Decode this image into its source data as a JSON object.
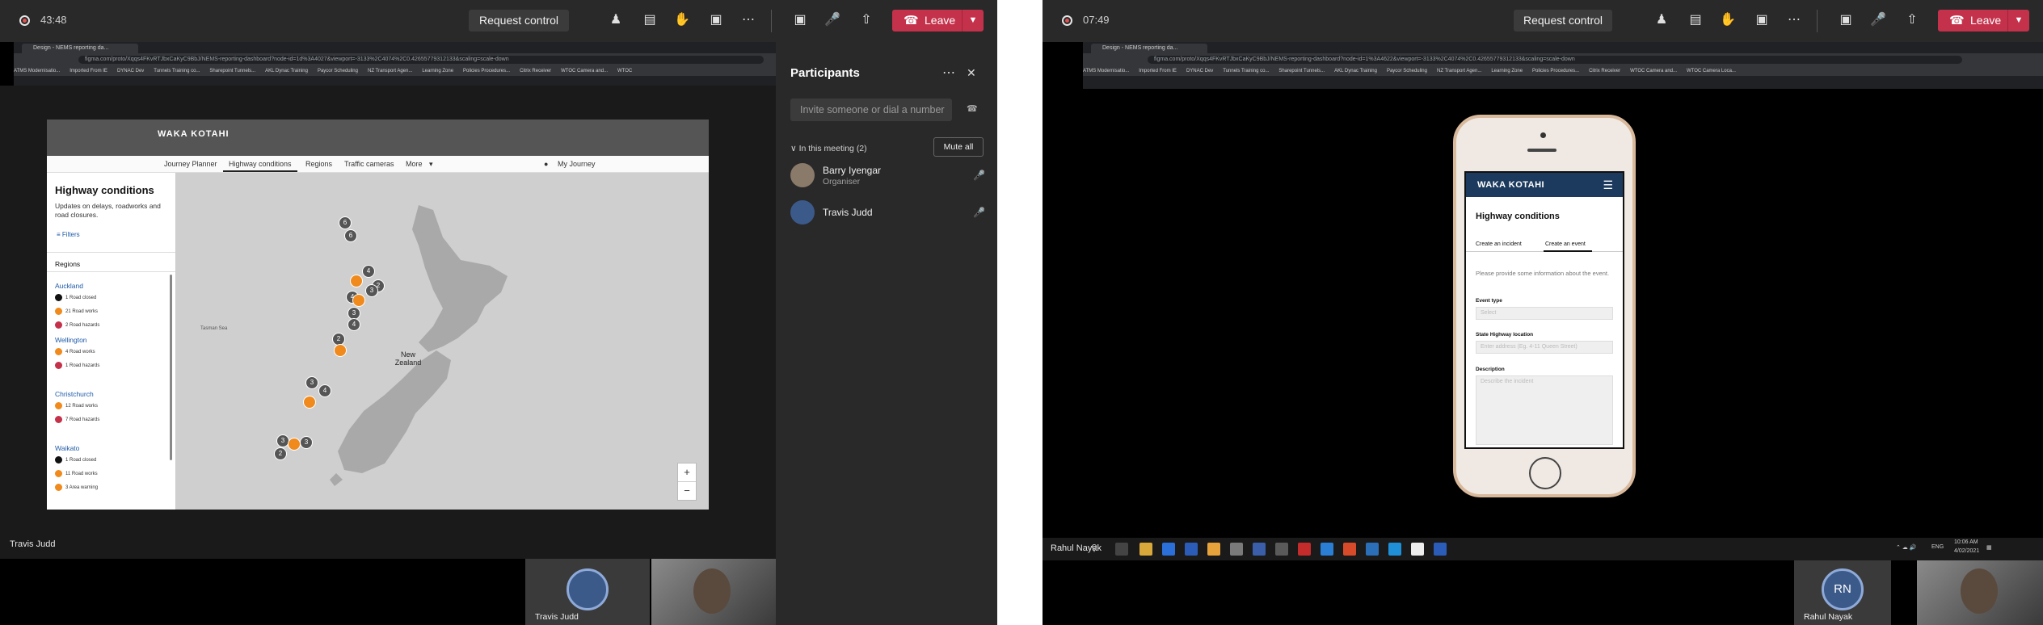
{
  "left": {
    "timer": "43:48",
    "request_control": "Request control",
    "leave": "Leave",
    "toolbar_icons": [
      "people-icon",
      "chat-icon",
      "raise-hand-icon",
      "rooms-icon",
      "more-icon",
      "camera-icon",
      "mic-icon",
      "share-icon"
    ],
    "browser": {
      "tab": "Design - NEMS reporting da...",
      "url": "figma.com/proto/Xqqs4FKvRTJbxCaKyC9BbJ/NEMS-reporting-dashboard?node-id=1d%3A4027&viewport=-3133%2C4074%2C0.42655779312133&scaling=scale-down",
      "bookmarks": [
        "ATMS Modernisatio...",
        "Imported From IE",
        "DYNAC Dev",
        "Tunnels Training co...",
        "Sharepoint Tunnels...",
        "AKL Dynac Training",
        "Paycor Scheduling",
        "NZ Transport Agen...",
        "Learning Zone",
        "Policies Procedures...",
        "Citrix Receiver",
        "WTOC Camera and...",
        "WTOC"
      ]
    },
    "figma": {
      "logo": "WAKA KOTAHI",
      "nav": [
        "Journey Planner",
        "Highway conditions",
        "Regions",
        "Traffic cameras",
        "More"
      ],
      "account": "My Journey",
      "title": "Highway conditions",
      "subtitle": "Updates on delays, roadworks and road closures.",
      "filters": "Filters",
      "regions_label": "Regions",
      "regions": [
        {
          "name": "Auckland",
          "items": [
            "1 Road closed",
            "21 Road works",
            "2 Road hazards"
          ]
        },
        {
          "name": "Wellington",
          "items": [
            "4 Road works",
            "1 Road hazards"
          ]
        },
        {
          "name": "Christchurch",
          "items": [
            "12 Road works",
            "7 Road hazards"
          ]
        },
        {
          "name": "Waikato",
          "items": [
            "1 Road closed",
            "11 Road works",
            "3 Area warning"
          ]
        }
      ],
      "map_labels": {
        "sea": "Tasman Sea",
        "country": "New Zealand"
      },
      "markers": [
        "6",
        "6",
        "4",
        "2",
        "3",
        "4",
        "3",
        "2",
        "4",
        "3",
        "4",
        "3",
        "2"
      ],
      "zoom_in": "+",
      "zoom_out": "−"
    },
    "presenter_name": "Travis Judd",
    "participants": {
      "title": "Participants",
      "invite_placeholder": "Invite someone or dial a number",
      "in_meeting": "In this meeting (2)",
      "mute_all": "Mute all",
      "people": [
        {
          "name": "Barry Iyengar",
          "role": "Organiser"
        },
        {
          "name": "Travis Judd",
          "role": ""
        }
      ]
    },
    "tiles": [
      {
        "name": "Travis Judd"
      },
      {
        "name": ""
      }
    ]
  },
  "right": {
    "timer": "07:49",
    "request_control": "Request control",
    "leave": "Leave",
    "browser": {
      "tab": "Design - NEMS reporting da...",
      "url": "figma.com/proto/Xqqs4FKvRTJbxCaKyC9BbJ/NEMS-reporting-dashboard?node-id=1%3A4622&viewport=-3133%2C4074%2C0.42655779312133&scaling=scale-down",
      "bookmarks": [
        "ATMS Modernisatio...",
        "Imported From IE",
        "DYNAC Dev",
        "Tunnels Training co...",
        "Sharepoint Tunnels...",
        "AKL Dynac Training",
        "Paycor Scheduling",
        "NZ Transport Agen...",
        "Learning Zone",
        "Policies Procedures...",
        "Citrix Receiver",
        "WTOC Camera and...",
        "WTOC Camera Loca..."
      ]
    },
    "phone": {
      "logo": "WAKA KOTAHI",
      "title": "Highway conditions",
      "tabs": [
        "Create an incident",
        "Create an event"
      ],
      "info": "Please provide some information about the event.",
      "event_type_label": "Event type",
      "event_type_placeholder": "Select",
      "location_label": "State Highway location",
      "location_placeholder": "Enter address (Eg. 4-11 Queen Street)",
      "description_label": "Description",
      "description_placeholder": "Describe the incident"
    },
    "presenter_name": "Rahul Nayak",
    "taskbar": {
      "lang": "ENG",
      "time": "10:06 AM",
      "date": "4/02/2021"
    },
    "tiles": [
      {
        "name": "Rahul Nayak",
        "initials": "RN"
      }
    ]
  },
  "colors": {
    "leave": "#c4314b",
    "toolbar": "#292929",
    "accent": "#1c3a5e",
    "marker_orange": "#f08a1c"
  }
}
